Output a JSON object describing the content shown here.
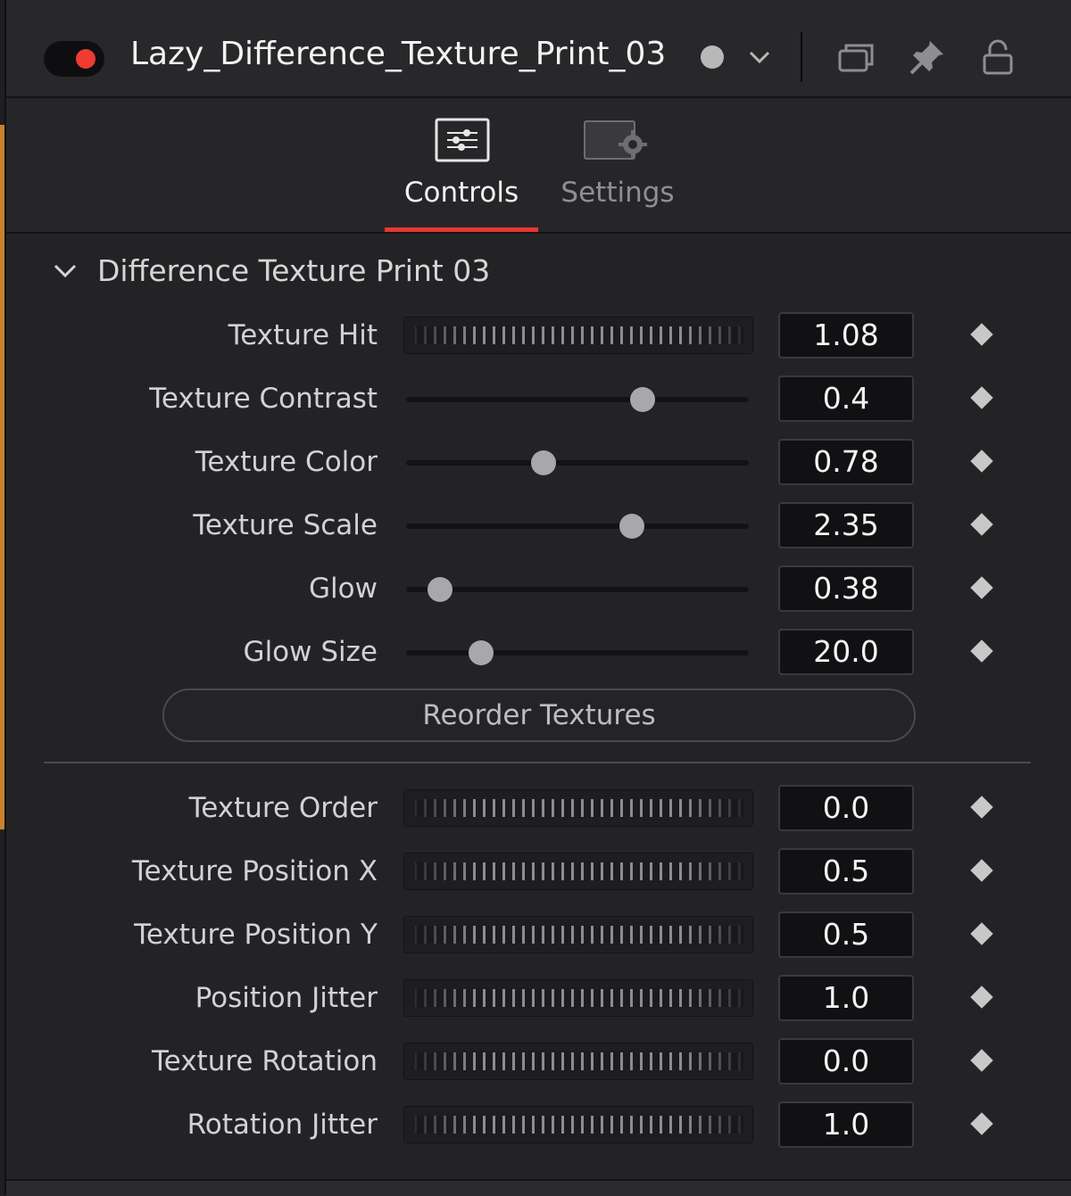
{
  "header": {
    "node_title": "Lazy_Difference_Texture_Print_03",
    "accent_color": "#ee3b34"
  },
  "tabs": [
    {
      "label": "Controls",
      "active": true
    },
    {
      "label": "Settings",
      "active": false
    }
  ],
  "section": {
    "title": "Difference Texture Print 03"
  },
  "group1": [
    {
      "label": "Texture Hit",
      "control": "thumbwheel",
      "value": "1.08"
    },
    {
      "label": "Texture Contrast",
      "control": "slider",
      "value": "0.4",
      "position": 0.69
    },
    {
      "label": "Texture Color",
      "control": "slider",
      "value": "0.78",
      "position": 0.4
    },
    {
      "label": "Texture Scale",
      "control": "slider",
      "value": "2.35",
      "position": 0.66
    },
    {
      "label": "Glow",
      "control": "slider",
      "value": "0.38",
      "position": 0.1
    },
    {
      "label": "Glow Size",
      "control": "slider",
      "value": "20.0",
      "position": 0.22
    }
  ],
  "reorder_button": "Reorder Textures",
  "group2": [
    {
      "label": "Texture Order",
      "control": "thumbwheel",
      "value": "0.0"
    },
    {
      "label": "Texture Position X",
      "control": "thumbwheel",
      "value": "0.5"
    },
    {
      "label": "Texture Position Y",
      "control": "thumbwheel",
      "value": "0.5"
    },
    {
      "label": "Position Jitter",
      "control": "thumbwheel",
      "value": "1.0"
    },
    {
      "label": "Texture Rotation",
      "control": "thumbwheel",
      "value": "0.0"
    },
    {
      "label": "Rotation Jitter",
      "control": "thumbwheel",
      "value": "1.0"
    }
  ]
}
